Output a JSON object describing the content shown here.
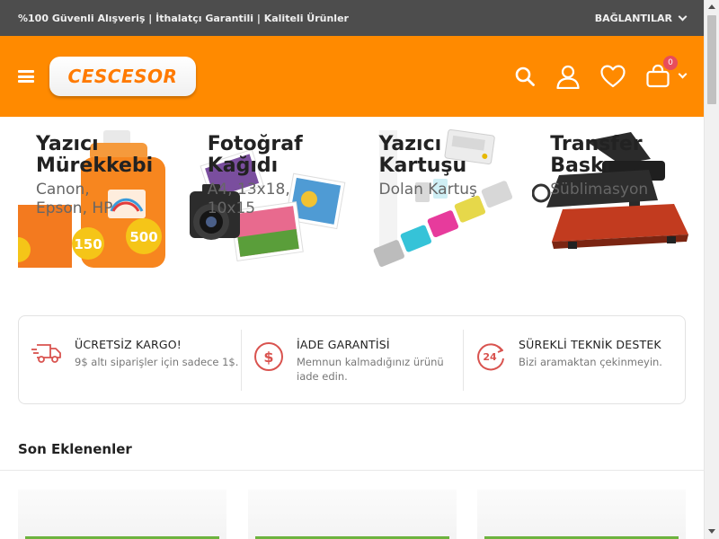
{
  "topbar": {
    "tagline": "%100 Güvenli Alışveriş | İthalatçı Garantili | Kaliteli Ürünler",
    "links_label": "BAĞLANTILAR"
  },
  "header": {
    "logo_text": "CESCESOR",
    "cart_count": "0",
    "icons": [
      "menu-icon",
      "search-icon",
      "user-icon",
      "heart-icon",
      "cart-icon",
      "chevron-down-icon"
    ],
    "colors": {
      "header_bg": "#ff8a00",
      "topbar_bg": "#4d4d4d",
      "badge": "#e84d5b",
      "feature_icon": "#d9534f"
    }
  },
  "banners": [
    {
      "title_line1": "Yazıcı",
      "title_line2": "Mürekkebi",
      "subtitle_line1": "Canon,",
      "subtitle_line2": "Epson, HP"
    },
    {
      "title_line1": "Fotoğraf",
      "title_line2": "Kağıdı",
      "subtitle_line1": "A4, 13x18,",
      "subtitle_line2": "10x15"
    },
    {
      "title_line1": "Yazıcı",
      "title_line2": "Kartuşu",
      "subtitle_line1": "Dolan Kartuş",
      "subtitle_line2": ""
    },
    {
      "title_line1": "Transfer",
      "title_line2": "Baskı",
      "subtitle_line1": "Süblimasyon",
      "subtitle_line2": ""
    }
  ],
  "features": [
    {
      "icon": "truck-icon",
      "title": "ÜCRETSİZ KARGO!",
      "desc": "9$ altı siparişler için sadece 1$."
    },
    {
      "icon": "dollar-icon",
      "title": "İADE GARANTİSİ",
      "desc": "Memnun kalmadığınız ürünü iade edin."
    },
    {
      "icon": "support-24-icon",
      "title": "SÜREKLİ TEKNİK DESTEK",
      "desc": "Bizi aramaktan çekinmeyin."
    }
  ],
  "section": {
    "title": "Son Eklenenler"
  }
}
